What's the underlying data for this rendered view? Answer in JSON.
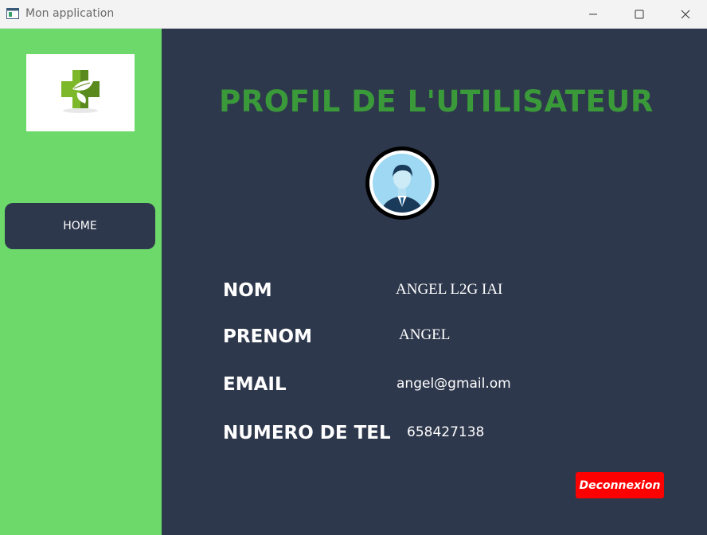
{
  "window": {
    "title": "Mon application",
    "icons": [
      "app-icon",
      "minimize-icon",
      "maximize-icon",
      "close-icon"
    ]
  },
  "sidebar": {
    "logo": "medical-cross-leaf-logo",
    "home_label": "HOME",
    "accent_color": "#6cd96a"
  },
  "main": {
    "title": "PROFIL DE L'UTILISATEUR",
    "avatar": "user-avatar",
    "fields": [
      {
        "label": "NOM",
        "value": "ANGEL L2G IAI"
      },
      {
        "label": "PRENOM",
        "value": "ANGEL"
      },
      {
        "label": "EMAIL",
        "value": "angel@gmail.om"
      },
      {
        "label": "NUMERO DE TEL",
        "value": "658427138"
      }
    ],
    "logout_label": "Deconnexion",
    "background_color": "#2e384c",
    "title_color": "#3a9a3a",
    "logout_color": "#ff0000"
  }
}
